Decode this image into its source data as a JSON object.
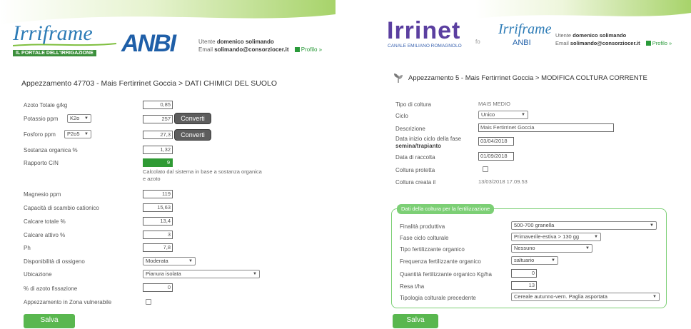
{
  "left": {
    "logo_text": "Irriframe",
    "logo_tagline": "IL PORTALE DELL'IRRIGAZIONE",
    "anbi_logo": "ANBI",
    "user_label": "Utente",
    "user_name": "domenico solimando",
    "email_label": "Email",
    "email": "solimando@consorziocer.it",
    "profile_link": "Profilo »",
    "page_title": "Appezzamento 47703 - Mais Fertirrinet Goccia > DATI CHIMICI DEL SUOLO",
    "fields": {
      "azoto_label": "Azoto Totale g/kg",
      "azoto_value": "0,85",
      "potassio_label": "Potassio ppm",
      "potassio_unit": "K2o",
      "potassio_value": "257",
      "fosforo_label": "Fosforo ppm",
      "fosforo_unit": "P2o5",
      "fosforo_value": "27,3",
      "convert_label": "Converti",
      "sostanza_label": "Sostanza organica %",
      "sostanza_value": "1,32",
      "rapporto_label": "Rapporto C/N",
      "rapporto_value": "9",
      "rapporto_note": "Calcolato dal sistema in base a sostanza organica e azoto",
      "magnesio_label": "Magnesio ppm",
      "magnesio_value": "119",
      "capacita_label": "Capacità di scambio cationico",
      "capacita_value": "15,63",
      "calcare_tot_label": "Calcare totale %",
      "calcare_tot_value": "13,4",
      "calcare_att_label": "Calcare attivo %",
      "calcare_att_value": "3",
      "ph_label": "Ph",
      "ph_value": "7,8",
      "ossigeno_label": "Disponibilità di ossigeno",
      "ossigeno_value": "Moderata",
      "ubicazione_label": "Ubicazione",
      "ubicazione_value": "Pianura isolata",
      "azoto_fiss_label": "% di azoto fissazione",
      "azoto_fiss_value": "0",
      "zona_label": "Appezzamento in Zona vulnerabile"
    },
    "save_label": "Salva"
  },
  "right": {
    "logo_text": "Irrinet",
    "logo_tagline": "CANALE EMILIANO ROMAGNOLO",
    "by_text": "fo",
    "irriframe_text": "Irriframe",
    "anbi_text": "ANBI",
    "user_label": "Utente",
    "user_name": "domenico solimando",
    "email_label": "Email",
    "email": "solimando@consorziocer.it",
    "profile_link": "Profilo »",
    "page_title": "Appezzamento 5 - Mais Fertirrinet Goccia > MODIFICA COLTURA CORRENTE",
    "fields": {
      "tipo_label": "Tipo di coltura",
      "tipo_value": "MAIS MEDIO",
      "ciclo_label": "Ciclo",
      "ciclo_value": "Unico",
      "descr_label": "Descrizione",
      "descr_value": "Mais Fertirrinet Goccia",
      "data_inizio_label": "Data inizio ciclo della fase",
      "data_inizio_label2": "semina/trapianto",
      "data_inizio_value": "03/04/2018",
      "data_raccolta_label": "Data di raccolta",
      "data_raccolta_value": "01/09/2018",
      "protetta_label": "Coltura protetta",
      "creata_label": "Coltura creata il",
      "creata_value": "13/03/2018 17.09.53"
    },
    "fert": {
      "legend": "Dati della coltura per la fertilizzazione",
      "finalita_label": "Finalità produttiva",
      "finalita_value": "500-700 granella",
      "fase_label": "Fase ciclo colturale",
      "fase_value": "Primaverile-estiva > 130 gg",
      "tipo_fert_label": "Tipo fertilizzante organico",
      "tipo_fert_value": "Nessuno",
      "freq_label": "Frequenza fertilizzante organico",
      "freq_value": "saltuario",
      "quant_label": "Quantità fertilizzante organico Kg/ha",
      "quant_value": "0",
      "resa_label": "Resa t/ha",
      "resa_value": "13",
      "tipologia_label": "Tipologia colturale precedente",
      "tipologia_value": "Cereale autunno-vern. Paglia asportata"
    },
    "save_label": "Salva"
  },
  "colors": {
    "accent_green": "#59b74f",
    "bar_green": "#2f9a34",
    "anbi_blue": "#1f5fa8",
    "irrinet_purple": "#5b3fa0"
  },
  "icons": {
    "leaf": "leaf-icon",
    "profile": "profile-icon"
  }
}
